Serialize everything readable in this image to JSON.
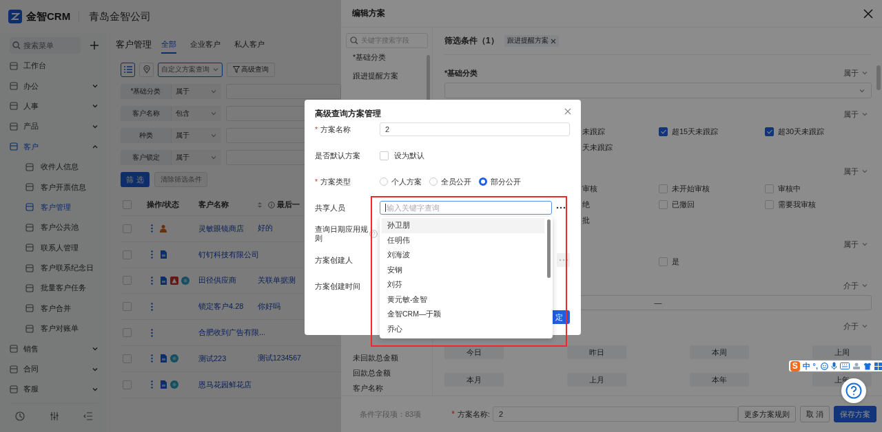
{
  "app": {
    "brand": "金智CRM",
    "company": "青岛金智公司",
    "sidebar": {
      "search_placeholder": "搜索菜单",
      "items": [
        {
          "label": "工作台",
          "kind": "link",
          "selected": false
        },
        {
          "label": "办公",
          "kind": "group",
          "expanded": false,
          "selected": false
        },
        {
          "label": "人事",
          "kind": "group",
          "expanded": false,
          "selected": false
        },
        {
          "label": "产品",
          "kind": "group",
          "expanded": false,
          "selected": false
        },
        {
          "label": "客户",
          "kind": "group",
          "expanded": true,
          "selected": true,
          "children": [
            {
              "label": "收件人信息",
              "selected": false
            },
            {
              "label": "客户开票信息",
              "selected": false
            },
            {
              "label": "客户管理",
              "selected": true
            },
            {
              "label": "客户公共池",
              "selected": false
            },
            {
              "label": "联系人管理",
              "selected": false
            },
            {
              "label": "客户联系纪念日",
              "selected": false
            },
            {
              "label": "批量客户任务",
              "selected": false
            },
            {
              "label": "客户合并",
              "selected": false
            },
            {
              "label": "客户对账单",
              "selected": false
            }
          ]
        },
        {
          "label": "销售",
          "kind": "group",
          "expanded": false,
          "selected": false
        },
        {
          "label": "合同",
          "kind": "group",
          "expanded": false,
          "selected": false
        },
        {
          "label": "客服",
          "kind": "group",
          "expanded": false,
          "selected": false
        }
      ]
    },
    "main": {
      "title": "客户管理",
      "tabs": [
        {
          "label": "全部",
          "selected": true
        },
        {
          "label": "企业客户",
          "selected": false
        },
        {
          "label": "私人客户",
          "selected": false
        }
      ],
      "views": [
        {
          "kind": "list",
          "selected": true
        },
        {
          "kind": "map",
          "selected": false
        }
      ],
      "scheme_select": {
        "placeholder": "自定义方案查询"
      },
      "advanced_button": "高级查询",
      "filters": [
        {
          "label": "*基础分类",
          "operator": "属于"
        },
        {
          "label": "客户名称",
          "operator": "包含"
        },
        {
          "label": "种类",
          "operator": "属于"
        },
        {
          "label": "客户锁定",
          "operator": "属于"
        }
      ],
      "filter_button": "筛 选",
      "clear_button": {
        "label": "清除筛选条件",
        "disabled": true
      },
      "table": {
        "columns": [
          "操作/状态",
          "客户名称",
          "最后一"
        ],
        "all_checked": false,
        "rows": [
          {
            "checked": false,
            "badges": [
              {
                "kind": "person"
              }
            ],
            "name": "灵敏眼镜商店",
            "last": "好的"
          },
          {
            "checked": false,
            "badges": [
              {
                "kind": "document"
              }
            ],
            "name": "钉钉科技有限公司"
          },
          {
            "checked": false,
            "badges": [
              {
                "kind": "document"
              },
              {
                "kind": "warning"
              },
              {
                "kind": "dot"
              }
            ],
            "name": "田径供应商",
            "last": "关联单据测"
          },
          {
            "checked": false,
            "badges": [],
            "name": "锁定客户4.28",
            "last": "你好吗"
          },
          {
            "checked": false,
            "badges": [],
            "name": "合肥收到广告有限..."
          },
          {
            "checked": false,
            "badges": [
              {
                "kind": "document"
              },
              {
                "kind": "dot"
              }
            ],
            "name": "测试223",
            "last": "测试1234567"
          },
          {
            "checked": false,
            "badges": [
              {
                "kind": "document"
              },
              {
                "kind": "dot"
              }
            ],
            "name": "恩马花园鲜花店"
          }
        ]
      }
    }
  },
  "drawer": {
    "title": "编辑方案",
    "search_placeholder": "关键字搜索字段",
    "fields_top": [
      "*基础分类",
      "跟进提醒方案"
    ],
    "fields_bottom": [
      "未回款总金额",
      "回款总金额",
      "客户名称"
    ],
    "filter_title": "筛选条件（1）",
    "tag": "跟进提醒方案",
    "conditions": [
      {
        "kind": "select",
        "label": "*基础分类",
        "operator": "属于"
      },
      {
        "kind": "checks",
        "operator": "属于",
        "options": [
          {
            "label": "未跟踪"
          },
          {
            "label": "超15天未跟踪",
            "checked": true
          },
          {
            "label": "超30天未跟踪",
            "checked": true
          },
          {
            "label": "天未跟踪"
          }
        ]
      },
      {
        "kind": "checks",
        "operator": "属于",
        "options": [
          {
            "label": "审核"
          },
          {
            "label": "未开始审核",
            "checked": false
          },
          {
            "label": "审核中",
            "checked": false
          },
          {
            "label": "绝"
          },
          {
            "label": "已撤回",
            "checked": false
          },
          {
            "label": "需要我审核",
            "checked": false
          },
          {
            "label": "批"
          }
        ]
      },
      {
        "kind": "flag",
        "operator": "属于",
        "options": [
          {
            "label": "是",
            "checked": false
          }
        ]
      },
      {
        "kind": "range",
        "operator": "介于",
        "separator": "—"
      },
      {
        "kind": "dates",
        "operator": "介于",
        "options": [
          "今日",
          "昨日",
          "本周",
          "上周",
          "本月",
          "上月",
          "本年",
          "上年"
        ]
      }
    ],
    "footer": {
      "count": "条件字段项：83项",
      "mark": "*",
      "name_label": "方案名称:",
      "name_value": "2",
      "buttons": [
        {
          "label": "更多方案规则",
          "kind": "default"
        },
        {
          "label": "取 消",
          "kind": "default"
        },
        {
          "label": "保存方案",
          "kind": "primary"
        }
      ]
    }
  },
  "modal": {
    "title": "高级查询方案管理",
    "fields": [
      {
        "kind": "text",
        "label": "方案名称",
        "mark": "*",
        "value": "2"
      },
      {
        "kind": "checkbox",
        "label": "是否默认方案",
        "option": "设为默认",
        "checked": false
      },
      {
        "kind": "radio",
        "label": "方案类型",
        "mark": "*",
        "options": [
          {
            "label": "个人方案",
            "selected": false
          },
          {
            "label": "全员公开",
            "selected": false
          },
          {
            "label": "部分公开",
            "selected": true
          }
        ]
      },
      {
        "kind": "picker",
        "label": "共享人员",
        "placeholder": "输入关键字查询",
        "focused": true,
        "disabled": false
      },
      {
        "kind": "rule",
        "label": "查询日期应用规则"
      },
      {
        "kind": "locked",
        "label": "方案创建人",
        "disabled": true
      },
      {
        "kind": "plain",
        "label": "方案创建时间"
      }
    ],
    "confirm": "定"
  },
  "dropdown": {
    "options": [
      {
        "label": "孙卫朋",
        "hovered": true
      },
      {
        "label": "任明伟",
        "hovered": false
      },
      {
        "label": "刘海波",
        "hovered": false
      },
      {
        "label": "安钢",
        "hovered": false
      },
      {
        "label": "刘芬",
        "hovered": false
      },
      {
        "label": "黄元敏-金智",
        "hovered": false
      },
      {
        "label": "金智CRM—于颖",
        "hovered": false
      },
      {
        "label": "乔心",
        "hovered": false
      }
    ]
  },
  "annotations": [
    {
      "kind": "frame"
    }
  ],
  "ime_toolbar": {
    "logo": "S",
    "mode": "中",
    "punct": "°,"
  }
}
